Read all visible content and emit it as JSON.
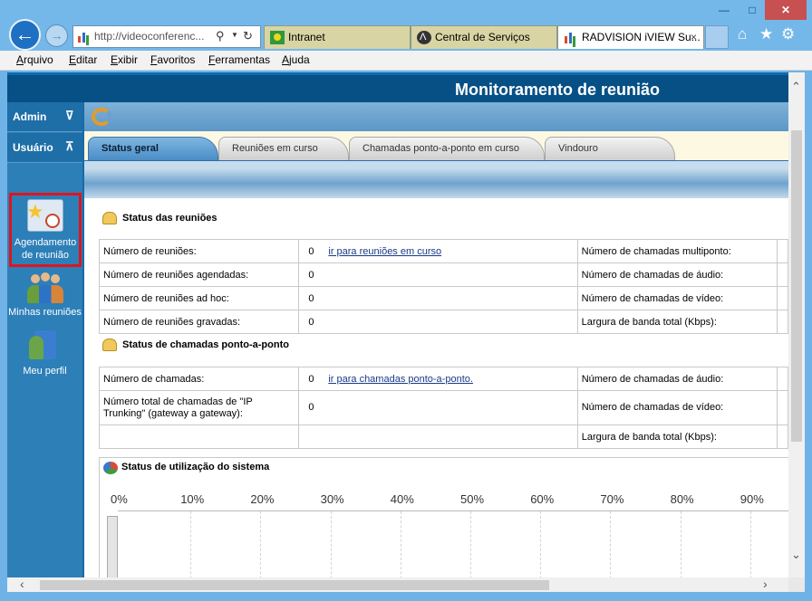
{
  "browser": {
    "address": "http://videoconferenc...",
    "tabs": [
      {
        "label": "Intranet"
      },
      {
        "label": "Central de Serviços"
      },
      {
        "label": "RADVISION iVIEW Su..."
      }
    ],
    "tab_close": "×"
  },
  "menu": [
    "Arquivo",
    "Editar",
    "Exibir",
    "Favoritos",
    "Ferramentas",
    "Ajuda"
  ],
  "page": {
    "title": "Monitoramento de reunião",
    "nav": {
      "admin": "Admin",
      "usuario": "Usuário",
      "items": [
        {
          "label": "Agendamento de reunião"
        },
        {
          "label": "Minhas reuniões"
        },
        {
          "label": "Meu perfil"
        }
      ]
    },
    "tabs": [
      "Status geral",
      "Reuniões em curso",
      "Chamadas ponto-a-ponto em curso",
      "Vindouro"
    ],
    "reunioes": {
      "title": "Status das reuniões",
      "rows": [
        {
          "label": "Número de reuniões:",
          "value": "0",
          "link": "ir para reuniões em curso",
          "right": "Número de chamadas multiponto:"
        },
        {
          "label": "Número de reuniões agendadas:",
          "value": "0",
          "link": "",
          "right": "Número de chamadas de áudio:"
        },
        {
          "label": "Número de reuniões ad hoc:",
          "value": "0",
          "link": "",
          "right": "Número de chamadas de vídeo:"
        },
        {
          "label": "Número de reuniões gravadas:",
          "value": "0",
          "link": "",
          "right": "Largura de banda total (Kbps):"
        }
      ]
    },
    "chamadas": {
      "title": "Status de chamadas ponto-a-ponto",
      "rows": [
        {
          "label": "Número de chamadas:",
          "value": "0",
          "link": "ir para chamadas ponto-a-ponto.",
          "right": "Número de chamadas de áudio:"
        },
        {
          "label": "Número total de chamadas de \"IP Trunking\" (gateway a gateway):",
          "value": "0",
          "link": "",
          "right": "Número de chamadas de vídeo:"
        },
        {
          "label": "",
          "value": "",
          "link": "",
          "right": "Largura de banda total (Kbps):"
        }
      ]
    },
    "sistema": {
      "title": "Status de utilização do sistema",
      "axis": [
        "0%",
        "10%",
        "20%",
        "30%",
        "40%",
        "50%",
        "60%",
        "70%",
        "80%",
        "90%"
      ]
    }
  },
  "colors": {
    "header": "#065086",
    "nav": "#2d7fb8",
    "highlight": "#e0141e",
    "active_tab": "#4a8dc6"
  },
  "icons": {
    "back": "back-arrow-icon",
    "forward": "forward-arrow-icon",
    "home": "home-icon",
    "favorites": "star-icon",
    "tools": "gear-icon",
    "refresh": "refresh-icon",
    "search": "search-icon"
  }
}
